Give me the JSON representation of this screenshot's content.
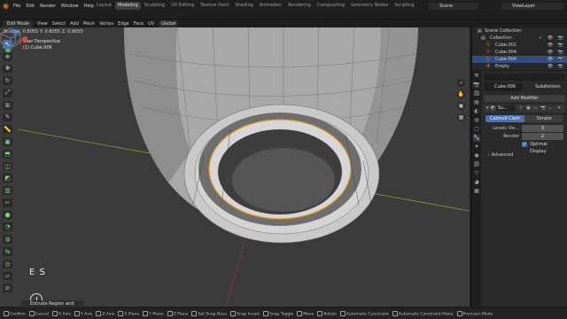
{
  "menubar": {
    "items": [
      "File",
      "Edit",
      "Render",
      "Window",
      "Help"
    ],
    "workspaces": [
      "Layout",
      "Modeling",
      "Sculpting",
      "UV Editing",
      "Texture Paint",
      "Shading",
      "Animation",
      "Rendering",
      "Compositing",
      "Geometry Nodes",
      "Scripting"
    ],
    "active_workspace": "Modeling",
    "scene": "Scene",
    "view_layer": "ViewLayer"
  },
  "viewport_header": {
    "mode": "Edit Mode",
    "menus": [
      "View",
      "Select",
      "Add",
      "Mesh",
      "Vertex",
      "Edge",
      "Face",
      "UV"
    ],
    "orientation": "Global"
  },
  "viewport": {
    "scale_info": "Scale X: 0.8055  Y: 0.8055  Z: 0.8055",
    "view_name": "User Perspective",
    "object_label": "(1) Cube.006",
    "key_overlay": "E S",
    "extrude_panel": "Extrude Region and Move"
  },
  "outliner": {
    "title": "Scene Collection",
    "rows": [
      {
        "label": "Scene Collection",
        "indent": 0,
        "selected": false
      },
      {
        "label": "Collection",
        "indent": 1,
        "selected": false
      },
      {
        "label": "Cube.001",
        "indent": 2,
        "selected": false
      },
      {
        "label": "Cube.004",
        "indent": 2,
        "selected": false
      },
      {
        "label": "Cube.006",
        "indent": 2,
        "selected": true
      },
      {
        "label": "Empty",
        "indent": 2,
        "selected": false
      }
    ]
  },
  "properties": {
    "object_name": "Cube.006",
    "modifier_tab": "Subdivision",
    "add_modifier": "Add Modifier",
    "modifier_short": "Su...",
    "methods": [
      "Catmull-Clark",
      "Simple"
    ],
    "levels_label": "Levels Vie...",
    "levels_value": "3",
    "render_label": "Render",
    "render_value": "2",
    "optimal_display": "Optimal Display",
    "advanced": "Advanced"
  },
  "statusbar": {
    "items": [
      "Confirm",
      "Cancel",
      "X Axis",
      "Y Axis",
      "Z Axis",
      "X Plane",
      "Y Plane",
      "Z Plane",
      "Set Snap Base",
      "Snap Invert",
      "Snap Toggle",
      "Move",
      "Rotate",
      "Automatic Constraint",
      "Automatic Constraint Plane",
      "Precision Mode"
    ]
  },
  "colors": {
    "accent": "#4772b3",
    "selected_row": "#334d80",
    "brand_orange": "#e87d0d"
  }
}
